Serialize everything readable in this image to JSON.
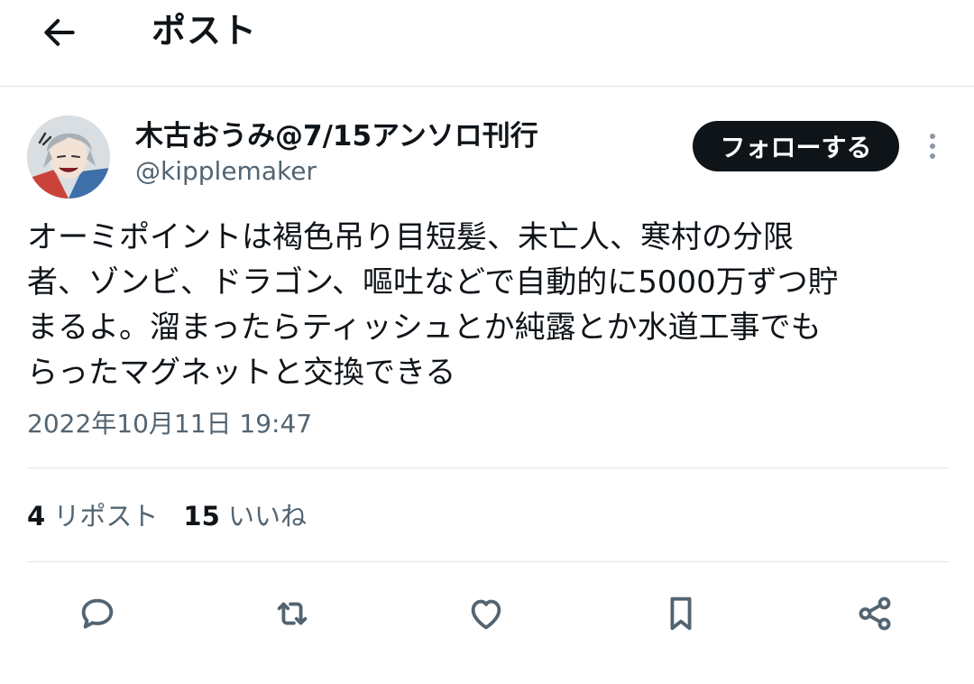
{
  "header": {
    "title": "ポスト",
    "back_icon": "arrow-left-icon"
  },
  "author": {
    "display_name": "木古おうみ@7/15アンソロ刊行",
    "handle": "@kipplemaker",
    "follow_label": "フォローする",
    "more_icon": "more-vertical-icon"
  },
  "post": {
    "text": "オーミポイントは褐色吊り目短髪、未亡人、寒村の分限\n者、ゾンビ、ドラゴン、嘔吐などで自動的に5000万ずつ貯\nまるよ。溜まったらティッシュとか純露とか水道工事でも\nらったマグネットと交換できる",
    "timestamp": "2022年10月11日 19:47"
  },
  "stats": {
    "reposts_count": "4",
    "reposts_label": "リポスト",
    "likes_count": "15",
    "likes_label": "いいね"
  },
  "actions": [
    {
      "icon": "reply-icon"
    },
    {
      "icon": "repost-icon"
    },
    {
      "icon": "like-icon"
    },
    {
      "icon": "bookmark-icon"
    },
    {
      "icon": "share-icon"
    }
  ],
  "colors": {
    "text_primary": "#0f1419",
    "text_secondary": "#536471",
    "follow_button_bg": "#0f1419",
    "divider": "#e3e6e8"
  }
}
